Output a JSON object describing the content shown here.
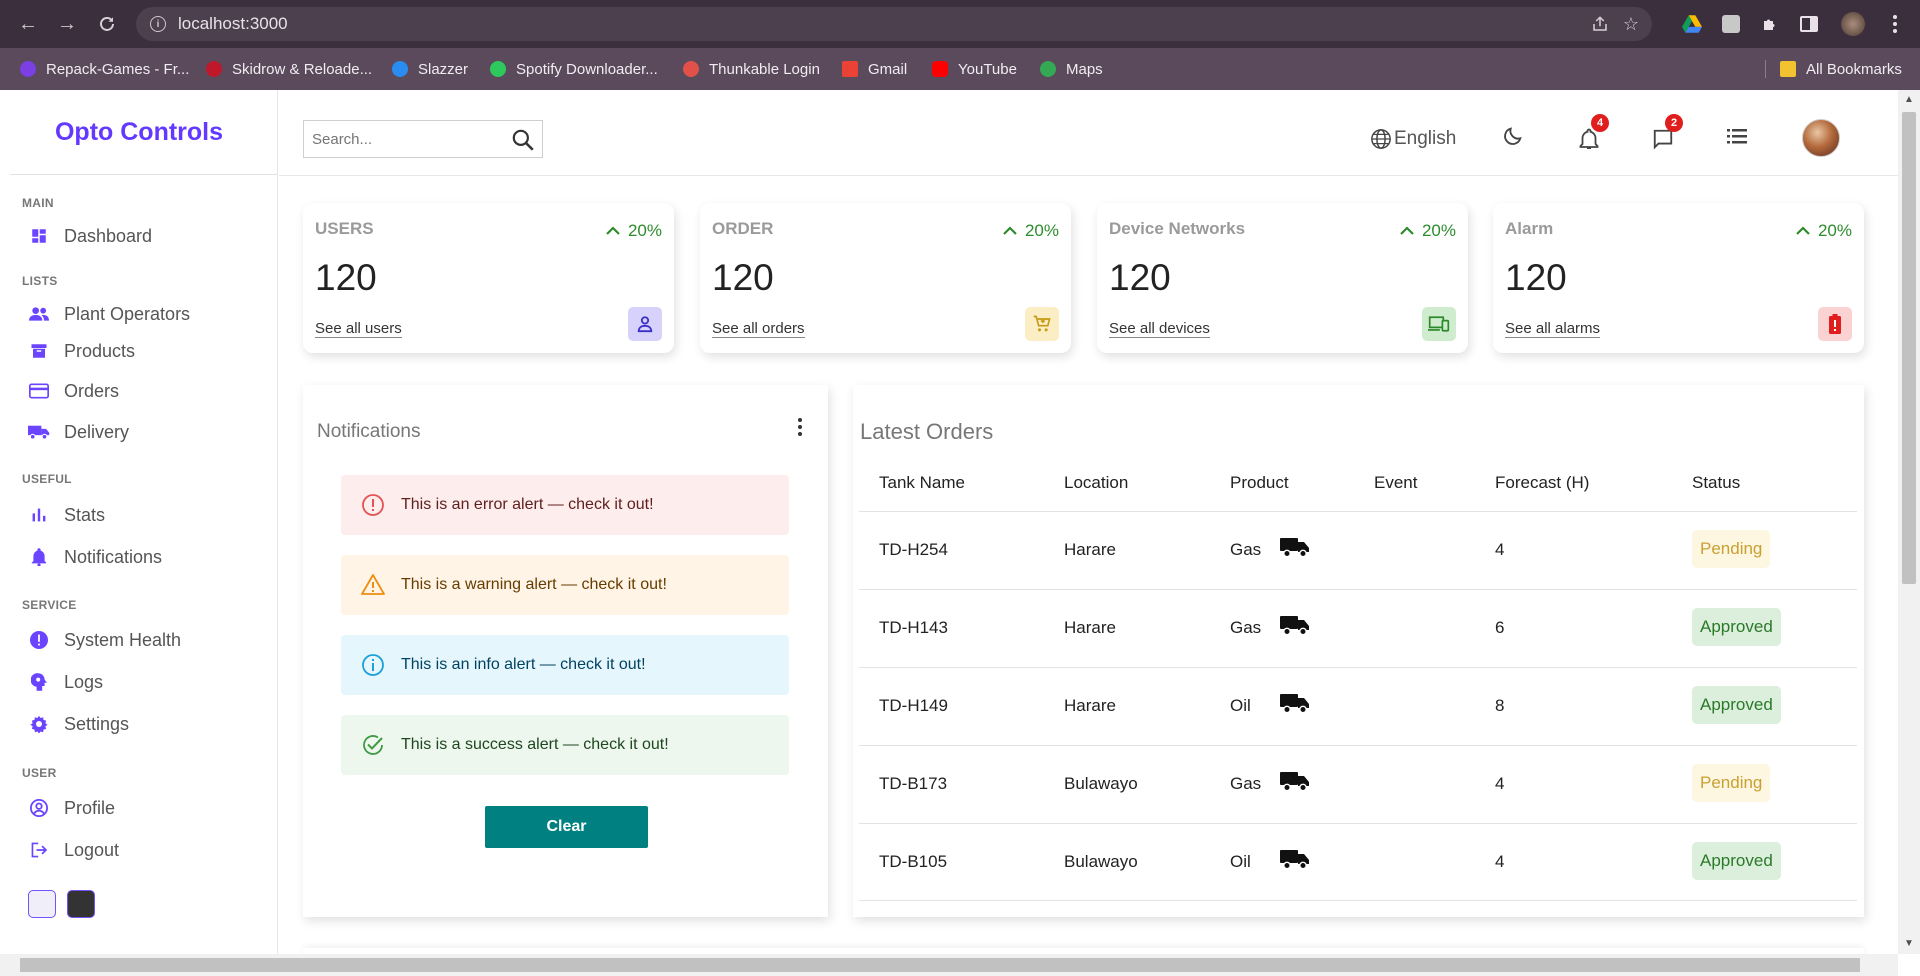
{
  "browser": {
    "url": "localhost:3000",
    "bookmarks": [
      {
        "label": "Repack-Games - Fr...",
        "color": "#7b3fe4"
      },
      {
        "label": "Skidrow & Reloade...",
        "color": "#c0182b"
      },
      {
        "label": "Slazzer",
        "color": "#2a8cf0"
      },
      {
        "label": "Spotify Downloader...",
        "color": "#2ec95c"
      },
      {
        "label": "Thunkable Login",
        "color": "#e2504a"
      },
      {
        "label": "Gmail",
        "color": "#ea4335"
      },
      {
        "label": "YouTube",
        "color": "#ff0000"
      },
      {
        "label": "Maps",
        "color": "#34a853"
      }
    ],
    "all_bookmarks": "All Bookmarks"
  },
  "sidebar": {
    "logo": "Opto Controls",
    "sections": {
      "main": "MAIN",
      "lists": "LISTS",
      "useful": "USEFUL",
      "service": "SERVICE",
      "user": "USER"
    },
    "items": {
      "dashboard": "Dashboard",
      "plant_operators": "Plant Operators",
      "products": "Products",
      "orders": "Orders",
      "delivery": "Delivery",
      "stats": "Stats",
      "notifications": "Notifications",
      "system_health": "System Health",
      "logs": "Logs",
      "settings": "Settings",
      "profile": "Profile",
      "logout": "Logout"
    }
  },
  "topbar": {
    "search_placeholder": "Search...",
    "language": "English",
    "notifications_count": "4",
    "messages_count": "2"
  },
  "widgets": [
    {
      "title": "USERS",
      "percent": "20%",
      "count": "120",
      "link": "See all users",
      "icon": "person-icon",
      "icon_color": "#3b2fc9",
      "icon_bg": "#d6d2fb"
    },
    {
      "title": "ORDER",
      "percent": "20%",
      "count": "120",
      "link": "See all orders",
      "icon": "cart-icon",
      "icon_color": "#c99a14",
      "icon_bg": "#fbeec4"
    },
    {
      "title": "Device Networks",
      "percent": "20%",
      "count": "120",
      "link": "See all devices",
      "icon": "devices-icon",
      "icon_color": "#2a8a2a",
      "icon_bg": "#cfeccf"
    },
    {
      "title": "Alarm",
      "percent": "20%",
      "count": "120",
      "link": "See all alarms",
      "icon": "battery-alert-icon",
      "icon_color": "#e01e1e",
      "icon_bg": "#fbd2d2"
    }
  ],
  "notifications": {
    "title": "Notifications",
    "alerts": [
      {
        "type": "error",
        "text": "This is an error alert — check it out!",
        "bg": "#fdeded",
        "color": "#e35353"
      },
      {
        "type": "warning",
        "text": "This is a warning alert — check it out!",
        "bg": "#fff4e5",
        "color": "#ed8e12"
      },
      {
        "type": "info",
        "text": "This is an info alert — check it out!",
        "bg": "#e5f6fd",
        "color": "#1ba0d8"
      },
      {
        "type": "success",
        "text": "This is a success alert — check it out!",
        "bg": "#edf7ed",
        "color": "#3f9a44"
      }
    ],
    "clear_label": "Clear"
  },
  "orders": {
    "title": "Latest Orders",
    "columns": [
      "Tank Name",
      "Location",
      "Product",
      "Event",
      "Forecast (H)",
      "Status"
    ],
    "rows": [
      {
        "tank": "TD-H254",
        "location": "Harare",
        "product": "Gas",
        "event": "truck-icon",
        "forecast": "4",
        "status": "Pending"
      },
      {
        "tank": "TD-H143",
        "location": "Harare",
        "product": "Gas",
        "event": "truck-icon",
        "forecast": "6",
        "status": "Approved"
      },
      {
        "tank": "TD-H149",
        "location": "Harare",
        "product": "Oil",
        "event": "truck-icon",
        "forecast": "8",
        "status": "Approved"
      },
      {
        "tank": "TD-B173",
        "location": "Bulawayo",
        "product": "Gas",
        "event": "truck-icon",
        "forecast": "4",
        "status": "Pending"
      },
      {
        "tank": "TD-B105",
        "location": "Bulawayo",
        "product": "Oil",
        "event": "truck-icon",
        "forecast": "4",
        "status": "Approved"
      }
    ]
  },
  "theme": {
    "accent": "#6439ff",
    "light_swatch": "#f0eef8",
    "dark_swatch": "#333333"
  }
}
